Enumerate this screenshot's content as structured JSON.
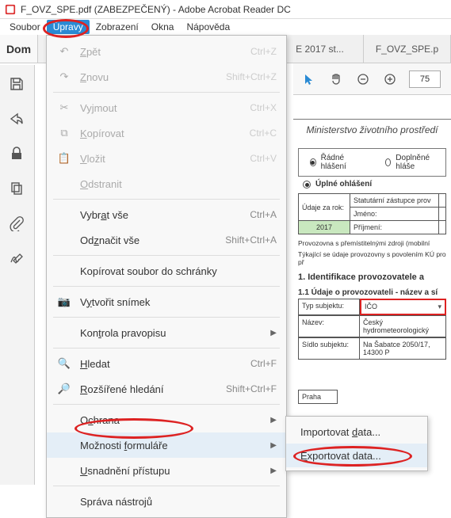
{
  "titlebar": {
    "text": "F_OVZ_SPE.pdf (ZABEZPEČENÝ) - Adobe Acrobat Reader DC"
  },
  "menubar": {
    "items": [
      "Soubor",
      "Úpravy",
      "Zobrazení",
      "Okna",
      "Nápověda"
    ]
  },
  "tabs": {
    "home": "Dom",
    "doc1": "E 2017 st...",
    "doc2": "F_OVZ_SPE.p"
  },
  "toolbar": {
    "zoom": "75"
  },
  "edit_menu": {
    "undo": "Zpět",
    "undo_sc": "Ctrl+Z",
    "redo": "Znovu",
    "redo_sc": "Shift+Ctrl+Z",
    "cut": "Vyjmout",
    "cut_sc": "Ctrl+X",
    "copy": "Kopírovat",
    "copy_sc": "Ctrl+C",
    "paste": "Vložit",
    "paste_sc": "Ctrl+V",
    "delete": "Odstranit",
    "select_all": "Vybrat vše",
    "select_all_sc": "Ctrl+A",
    "deselect": "Odznačit vše",
    "deselect_sc": "Shift+Ctrl+A",
    "copy_to_clip": "Kopírovat soubor do schránky",
    "snapshot": "Vytvořit snímek",
    "spellcheck": "Kontrola pravopisu",
    "find": "Hledat",
    "find_sc": "Ctrl+F",
    "advfind": "Rozšířené hledání",
    "advfind_sc": "Shift+Ctrl+F",
    "protection": "Ochrana",
    "form_opts": "Možnosti formuláře",
    "accessibility": "Usnadnění přístupu",
    "manage_tools": "Správa nástrojů"
  },
  "submenu": {
    "import": "Importovat data...",
    "export": "Exportovat data..."
  },
  "document": {
    "ministry": "Ministerstvo životního prostředí",
    "radne": "Řádné hlášení",
    "doplnene": "Doplněné hláše",
    "uplne": "Úplné ohlášení",
    "udaje_za_rok": "Údaje za rok:",
    "stat_zast": "Statutární zástupce prov",
    "jmeno": "Jméno:",
    "rok": "2017",
    "prijmeni": "Příjmení:",
    "prov_note1": "Provozovna s přemístitelnými zdroji (mobilní",
    "prov_note2": "Týkající se údaje provozovny s povolením KÚ pro př",
    "sect1": "1. Identifikace provozovatele a",
    "sect11": "1.1 Údaje o provozovateli - název a sí",
    "typ_subj_l": "Typ subjektu:",
    "typ_subj_v": "IČO",
    "nazev_l": "Název:",
    "nazev_v": "Český hydrometeorologický",
    "sidlo_l": "Sídlo subjektu:",
    "sidlo_v": "Na Šabatce 2050/17, 14300 P",
    "praha": "Praha"
  }
}
